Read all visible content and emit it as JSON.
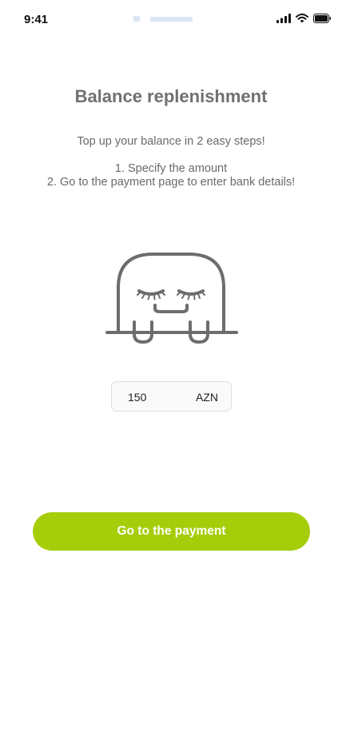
{
  "status_bar": {
    "time": "9:41"
  },
  "page": {
    "title": "Balance replenishment",
    "subtitle": "Top up your balance in 2 easy steps!",
    "steps": [
      "1. Specify the amount",
      "2. Go to the payment page to enter bank details!"
    ]
  },
  "amount": {
    "value": "150",
    "currency": "AZN"
  },
  "action": {
    "label": "Go to the payment"
  },
  "colors": {
    "accent": "#a6cd0a",
    "text": "#707070"
  },
  "icons": {
    "mascot": "sleepy-ghost-mascot",
    "signal": "cellular-signal-icon",
    "wifi": "wifi-icon",
    "battery": "battery-icon"
  }
}
